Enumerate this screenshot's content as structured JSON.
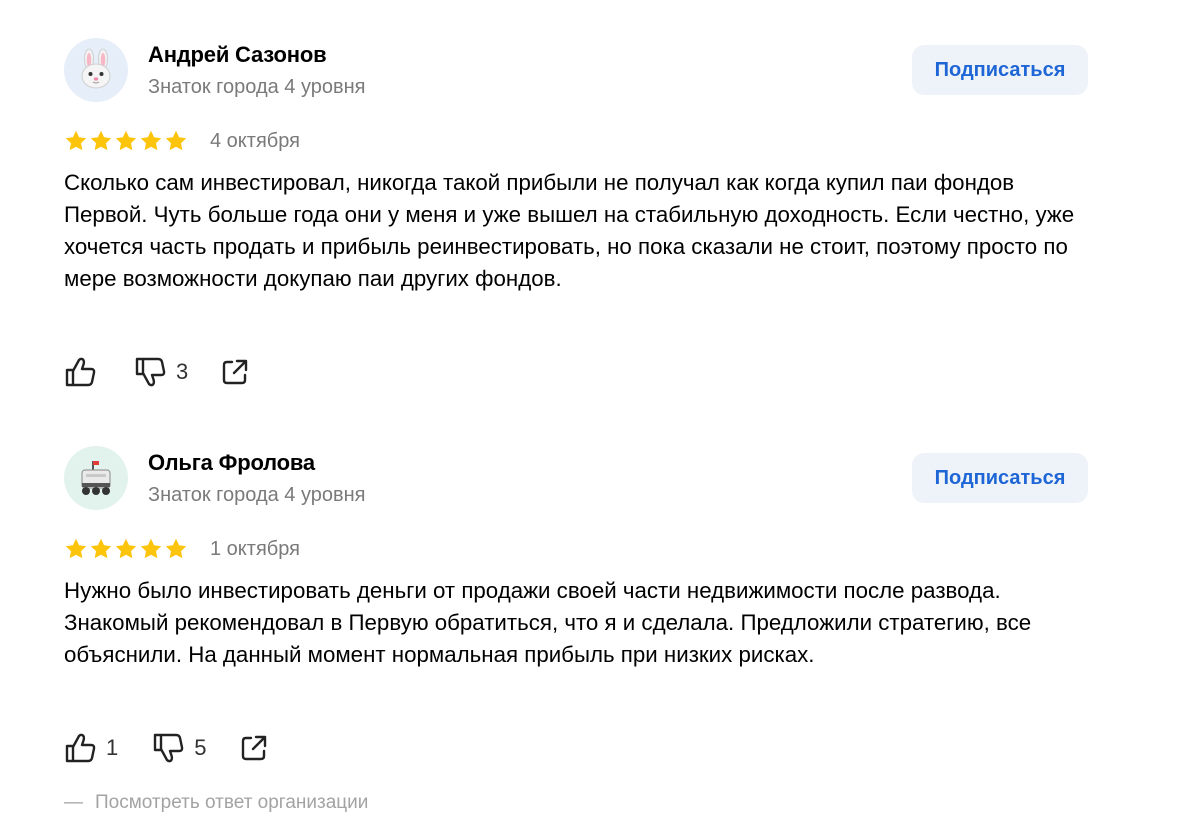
{
  "reviews": [
    {
      "author": "Андрей Сазонов",
      "level": "Знаток города 4 уровня",
      "avatar_icon": "bunny-face-icon",
      "subscribe_label": "Подписаться",
      "rating": 5,
      "date": "4 октября",
      "text": "Сколько сам инвестировал, никогда такой прибыли не получал как когда купил паи фондов Первой. Чуть больше года они у меня и уже вышел на стабильную доходность. Если честно, уже хочется часть продать и прибыль реинвестировать, но пока сказали не стоит, поэтому просто по мере возможности докупаю паи других фондов.",
      "likes": "",
      "dislikes": "3"
    },
    {
      "author": "Ольга Фролова",
      "level": "Знаток города 4 уровня",
      "avatar_icon": "delivery-robot-icon",
      "subscribe_label": "Подписаться",
      "rating": 5,
      "date": "1 октября",
      "text": "Нужно было инвестировать деньги от продажи своей части недвижимости после развода. Знакомый рекомендовал в Первую обратиться, что я и сделала. Предложили стратегию, все объяснили. На данный момент нормальная прибыль при низких рисках.",
      "likes": "1",
      "dislikes": "5"
    }
  ],
  "org_answer": {
    "dash": "—",
    "label": "Посмотреть ответ организации"
  },
  "colors": {
    "star": "#fcc40a",
    "accent": "#1e66d6",
    "subscribe_bg": "#eef3fa",
    "muted": "#7a7a7a"
  }
}
